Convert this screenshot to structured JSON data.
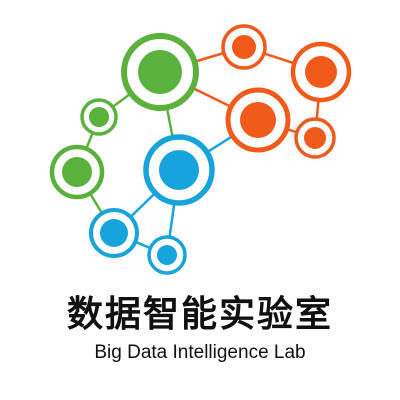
{
  "logo": {
    "icon": "network-nodes-icon",
    "colors": {
      "green": "#5ab23d",
      "orange": "#f05a1a",
      "blue": "#17a3dc"
    },
    "title_zh": "数据智能实验室",
    "title_en": "Big Data Intelligence Lab"
  }
}
